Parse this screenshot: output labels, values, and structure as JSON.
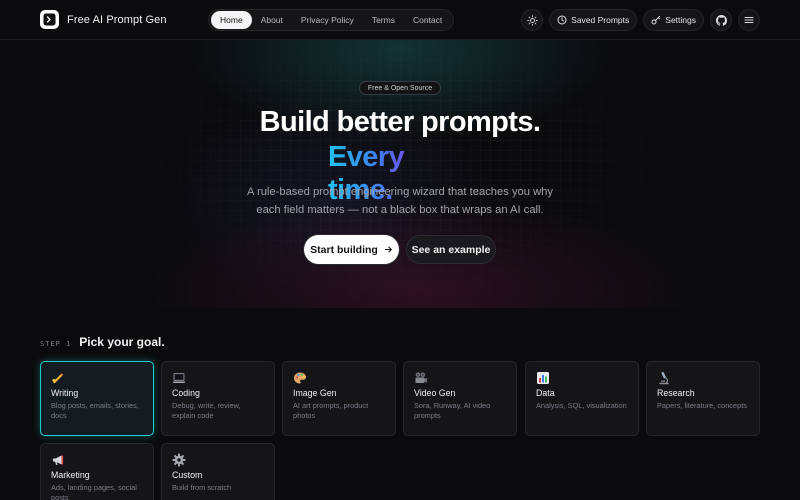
{
  "nav": {
    "brand": "Free AI Prompt Gen",
    "links": [
      {
        "label": "Home",
        "active": true
      },
      {
        "label": "About",
        "active": false
      },
      {
        "label": "Privacy Policy",
        "active": false
      },
      {
        "label": "Terms",
        "active": false
      },
      {
        "label": "Contact",
        "active": false
      }
    ],
    "saved_label": "Saved Prompts",
    "settings_label": "Settings",
    "icons": [
      "sun-icon",
      "clock-icon",
      "key-icon",
      "github-icon",
      "menu-icon"
    ]
  },
  "hero": {
    "badge": "Free & Open Source",
    "title_line1": "Build better prompts.",
    "title_line2": "Every time.",
    "subtitle_line1": "A rule-based prompt engineering wizard that teaches you why",
    "subtitle_line2": "each field matters — not a black box that wraps an AI call.",
    "primary_cta": "Start building",
    "secondary_cta": "See an example",
    "accent_colors": [
      "#1fc2ee",
      "#3f7df0",
      "#8a3cf0",
      "#d43ad8"
    ]
  },
  "step": {
    "label": "STEP 1",
    "title": "Pick your goal.",
    "selected_color": "#1fd2d2",
    "goals": [
      {
        "title": "Writing",
        "desc": "Blog posts, emails, stories, docs",
        "icon": "pencil-hand-icon",
        "selected": true
      },
      {
        "title": "Coding",
        "desc": "Debug, write, review, explain code",
        "icon": "laptop-icon",
        "selected": false
      },
      {
        "title": "Image Gen",
        "desc": "AI art prompts, product photos",
        "icon": "palette-icon",
        "selected": false
      },
      {
        "title": "Video Gen",
        "desc": "Sora, Runway, AI video prompts",
        "icon": "film-camera-icon",
        "selected": false
      },
      {
        "title": "Data",
        "desc": "Analysis, SQL, visualization",
        "icon": "bar-chart-icon",
        "selected": false
      },
      {
        "title": "Research",
        "desc": "Papers, literature, concepts",
        "icon": "microscope-icon",
        "selected": false
      },
      {
        "title": "Marketing",
        "desc": "Ads, landing pages, social posts",
        "icon": "megaphone-icon",
        "selected": false
      },
      {
        "title": "Custom",
        "desc": "Build from scratch",
        "icon": "gear-icon",
        "selected": false
      }
    ]
  }
}
